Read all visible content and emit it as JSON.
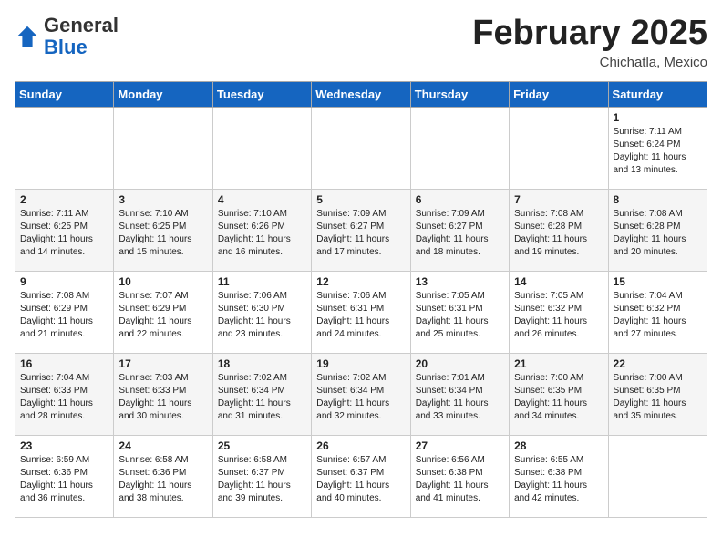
{
  "logo": {
    "general": "General",
    "blue": "Blue"
  },
  "header": {
    "month": "February 2025",
    "location": "Chichatla, Mexico"
  },
  "days_of_week": [
    "Sunday",
    "Monday",
    "Tuesday",
    "Wednesday",
    "Thursday",
    "Friday",
    "Saturday"
  ],
  "weeks": [
    [
      {
        "day": "",
        "info": ""
      },
      {
        "day": "",
        "info": ""
      },
      {
        "day": "",
        "info": ""
      },
      {
        "day": "",
        "info": ""
      },
      {
        "day": "",
        "info": ""
      },
      {
        "day": "",
        "info": ""
      },
      {
        "day": "1",
        "info": "Sunrise: 7:11 AM\nSunset: 6:24 PM\nDaylight: 11 hours\nand 13 minutes."
      }
    ],
    [
      {
        "day": "2",
        "info": "Sunrise: 7:11 AM\nSunset: 6:25 PM\nDaylight: 11 hours\nand 14 minutes."
      },
      {
        "day": "3",
        "info": "Sunrise: 7:10 AM\nSunset: 6:25 PM\nDaylight: 11 hours\nand 15 minutes."
      },
      {
        "day": "4",
        "info": "Sunrise: 7:10 AM\nSunset: 6:26 PM\nDaylight: 11 hours\nand 16 minutes."
      },
      {
        "day": "5",
        "info": "Sunrise: 7:09 AM\nSunset: 6:27 PM\nDaylight: 11 hours\nand 17 minutes."
      },
      {
        "day": "6",
        "info": "Sunrise: 7:09 AM\nSunset: 6:27 PM\nDaylight: 11 hours\nand 18 minutes."
      },
      {
        "day": "7",
        "info": "Sunrise: 7:08 AM\nSunset: 6:28 PM\nDaylight: 11 hours\nand 19 minutes."
      },
      {
        "day": "8",
        "info": "Sunrise: 7:08 AM\nSunset: 6:28 PM\nDaylight: 11 hours\nand 20 minutes."
      }
    ],
    [
      {
        "day": "9",
        "info": "Sunrise: 7:08 AM\nSunset: 6:29 PM\nDaylight: 11 hours\nand 21 minutes."
      },
      {
        "day": "10",
        "info": "Sunrise: 7:07 AM\nSunset: 6:29 PM\nDaylight: 11 hours\nand 22 minutes."
      },
      {
        "day": "11",
        "info": "Sunrise: 7:06 AM\nSunset: 6:30 PM\nDaylight: 11 hours\nand 23 minutes."
      },
      {
        "day": "12",
        "info": "Sunrise: 7:06 AM\nSunset: 6:31 PM\nDaylight: 11 hours\nand 24 minutes."
      },
      {
        "day": "13",
        "info": "Sunrise: 7:05 AM\nSunset: 6:31 PM\nDaylight: 11 hours\nand 25 minutes."
      },
      {
        "day": "14",
        "info": "Sunrise: 7:05 AM\nSunset: 6:32 PM\nDaylight: 11 hours\nand 26 minutes."
      },
      {
        "day": "15",
        "info": "Sunrise: 7:04 AM\nSunset: 6:32 PM\nDaylight: 11 hours\nand 27 minutes."
      }
    ],
    [
      {
        "day": "16",
        "info": "Sunrise: 7:04 AM\nSunset: 6:33 PM\nDaylight: 11 hours\nand 28 minutes."
      },
      {
        "day": "17",
        "info": "Sunrise: 7:03 AM\nSunset: 6:33 PM\nDaylight: 11 hours\nand 30 minutes."
      },
      {
        "day": "18",
        "info": "Sunrise: 7:02 AM\nSunset: 6:34 PM\nDaylight: 11 hours\nand 31 minutes."
      },
      {
        "day": "19",
        "info": "Sunrise: 7:02 AM\nSunset: 6:34 PM\nDaylight: 11 hours\nand 32 minutes."
      },
      {
        "day": "20",
        "info": "Sunrise: 7:01 AM\nSunset: 6:34 PM\nDaylight: 11 hours\nand 33 minutes."
      },
      {
        "day": "21",
        "info": "Sunrise: 7:00 AM\nSunset: 6:35 PM\nDaylight: 11 hours\nand 34 minutes."
      },
      {
        "day": "22",
        "info": "Sunrise: 7:00 AM\nSunset: 6:35 PM\nDaylight: 11 hours\nand 35 minutes."
      }
    ],
    [
      {
        "day": "23",
        "info": "Sunrise: 6:59 AM\nSunset: 6:36 PM\nDaylight: 11 hours\nand 36 minutes."
      },
      {
        "day": "24",
        "info": "Sunrise: 6:58 AM\nSunset: 6:36 PM\nDaylight: 11 hours\nand 38 minutes."
      },
      {
        "day": "25",
        "info": "Sunrise: 6:58 AM\nSunset: 6:37 PM\nDaylight: 11 hours\nand 39 minutes."
      },
      {
        "day": "26",
        "info": "Sunrise: 6:57 AM\nSunset: 6:37 PM\nDaylight: 11 hours\nand 40 minutes."
      },
      {
        "day": "27",
        "info": "Sunrise: 6:56 AM\nSunset: 6:38 PM\nDaylight: 11 hours\nand 41 minutes."
      },
      {
        "day": "28",
        "info": "Sunrise: 6:55 AM\nSunset: 6:38 PM\nDaylight: 11 hours\nand 42 minutes."
      },
      {
        "day": "",
        "info": ""
      }
    ]
  ]
}
